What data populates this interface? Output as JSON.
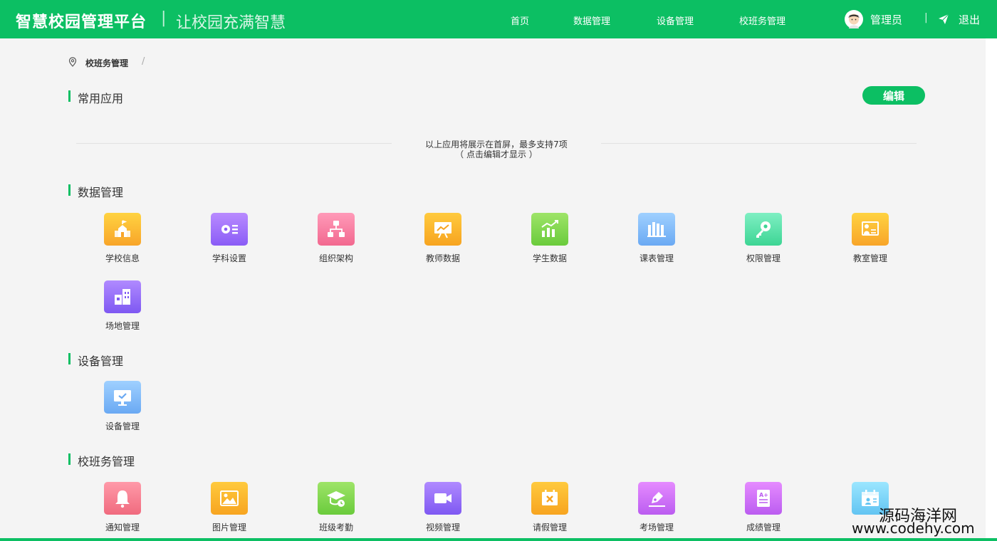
{
  "header": {
    "brand": "智慧校园管理平台",
    "separator": "|",
    "slogan": "让校园充满智慧",
    "nav": [
      "首页",
      "数据管理",
      "设备管理",
      "校班务管理"
    ],
    "user_name": "管理员",
    "user_separator": "|",
    "logout": "退出",
    "accent_color": "#0cbf63"
  },
  "breadcrumb": {
    "current": "校班务管理",
    "separator": "/"
  },
  "common_apps": {
    "title": "常用应用",
    "edit_button": "编辑",
    "hint_line1": "以上应用将展示在首屏，最多支持7项",
    "hint_line2": "（ 点击编辑才显示 ）"
  },
  "sections": {
    "data": {
      "title": "数据管理",
      "items": [
        {
          "label": "学校信息",
          "icon": "school-icon"
        },
        {
          "label": "学科设置",
          "icon": "subject-settings-icon"
        },
        {
          "label": "组织架构",
          "icon": "org-chart-icon"
        },
        {
          "label": "教师数据",
          "icon": "teacher-data-icon"
        },
        {
          "label": "学生数据",
          "icon": "student-data-icon"
        },
        {
          "label": "课表管理",
          "icon": "timetable-icon"
        },
        {
          "label": "权限管理",
          "icon": "key-icon"
        },
        {
          "label": "教室管理",
          "icon": "classroom-icon"
        },
        {
          "label": "场地管理",
          "icon": "building-icon"
        }
      ]
    },
    "device": {
      "title": "设备管理",
      "items": [
        {
          "label": "设备管理",
          "icon": "monitor-icon"
        }
      ]
    },
    "class_affairs": {
      "title": "校班务管理",
      "items": [
        {
          "label": "通知管理",
          "icon": "bell-icon"
        },
        {
          "label": "图片管理",
          "icon": "image-icon"
        },
        {
          "label": "班级考勤",
          "icon": "graduation-cap-icon"
        },
        {
          "label": "视频管理",
          "icon": "video-icon"
        },
        {
          "label": "请假管理",
          "icon": "leave-icon"
        },
        {
          "label": "考场管理",
          "icon": "pen-icon"
        },
        {
          "label": "成绩管理",
          "icon": "grade-icon"
        },
        {
          "label": "",
          "icon": "calendar-icon"
        }
      ]
    }
  },
  "watermark": {
    "line1": "源码海洋网",
    "line2": "www.codehy.com"
  }
}
